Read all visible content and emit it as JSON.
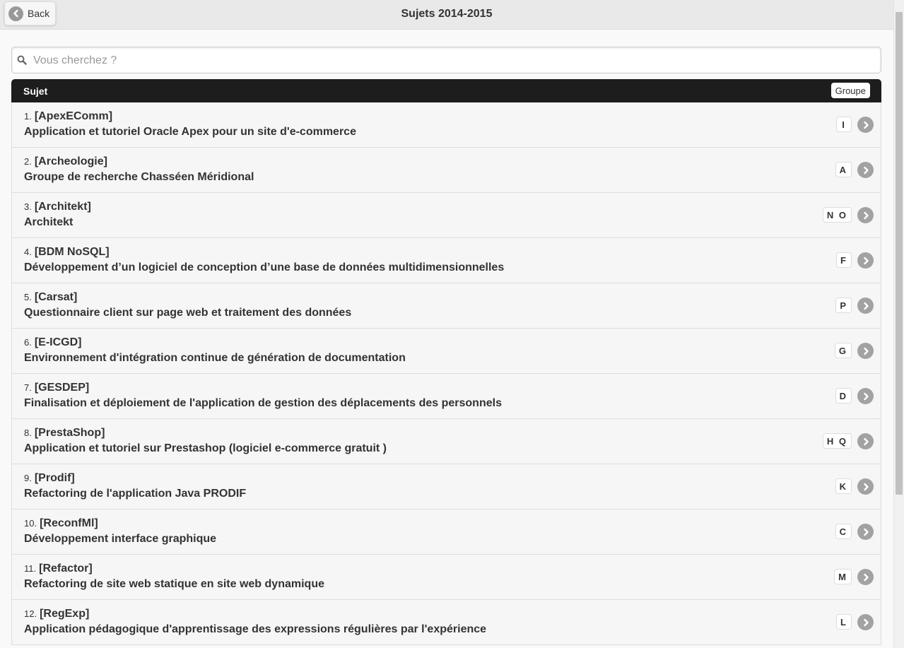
{
  "header": {
    "back_label": "Back",
    "title": "Sujets 2014-2015"
  },
  "search": {
    "placeholder": "Vous cherchez ?",
    "value": ""
  },
  "list_header": {
    "subject_label": "Sujet",
    "group_label": "Groupe"
  },
  "items": [
    {
      "num": "1.",
      "code": "[ApexEComm]",
      "desc": "Application et tutoriel Oracle Apex pour un site d'e-commerce",
      "group": "I"
    },
    {
      "num": "2.",
      "code": "[Archeologie]",
      "desc": "Groupe de recherche Chasséen Méridional",
      "group": "A"
    },
    {
      "num": "3.",
      "code": "[Architekt]",
      "desc": "Architekt",
      "group": "N O"
    },
    {
      "num": "4.",
      "code": "[BDM NoSQL]",
      "desc": "Développement d’un logiciel de conception d’une base de données multidimensionnelles",
      "group": "F"
    },
    {
      "num": "5.",
      "code": "[Carsat]",
      "desc": "Questionnaire client sur page web et traitement des données",
      "group": "P"
    },
    {
      "num": "6.",
      "code": "[E-ICGD]",
      "desc": "Environnement d'intégration continue de génération de documentation",
      "group": "G"
    },
    {
      "num": "7.",
      "code": "[GESDEP]",
      "desc": "Finalisation et déploiement de l'application de gestion des déplacements des personnels",
      "group": "D"
    },
    {
      "num": "8.",
      "code": "[PrestaShop]",
      "desc": "Application et tutoriel sur Prestashop (logiciel e-commerce gratuit )",
      "group": "H Q"
    },
    {
      "num": "9.",
      "code": "[Prodif]",
      "desc": "Refactoring de l'application Java PRODIF",
      "group": "K"
    },
    {
      "num": "10.",
      "code": "[ReconfMl]",
      "desc": "Développement interface graphique",
      "group": "C"
    },
    {
      "num": "11.",
      "code": "[Refactor]",
      "desc": "Refactoring de site web statique en site web dynamique",
      "group": "M"
    },
    {
      "num": "12.",
      "code": "[RegExp]",
      "desc": "Application pédagogique d'apprentissage des expressions régulières par l'expérience",
      "group": "L"
    }
  ],
  "colors": {
    "header_bg": "#e9e9e9",
    "list_header_bg": "#1d1d1d",
    "row_bg": "#f6f6f6",
    "arrow_icon": "#a2a2a2"
  }
}
